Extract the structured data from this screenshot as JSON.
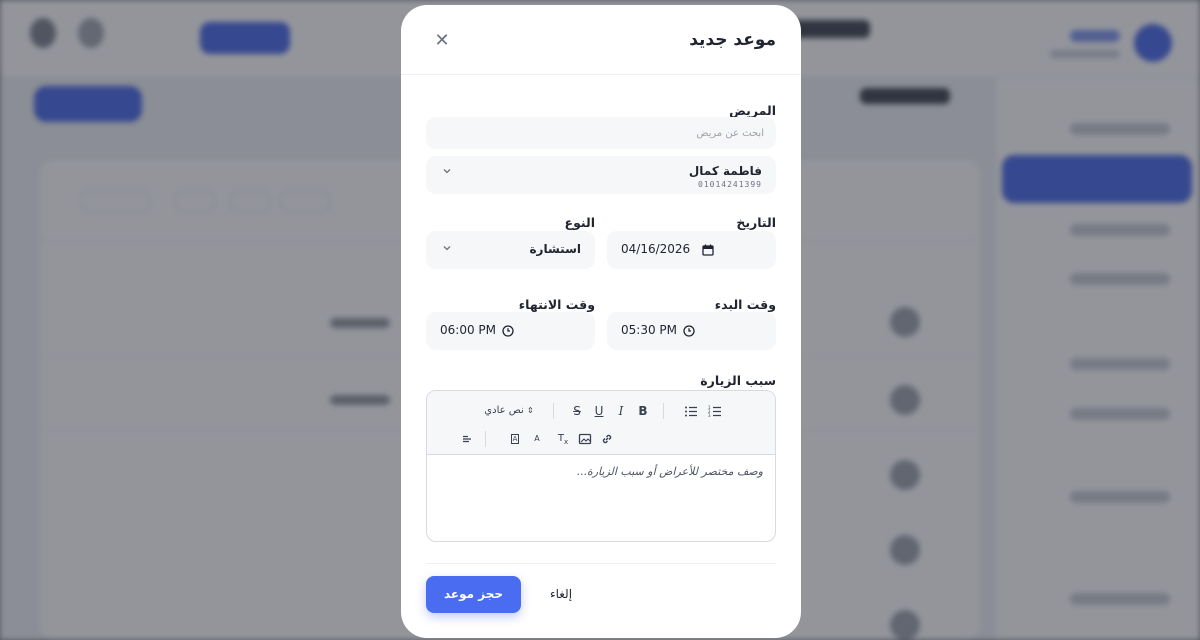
{
  "modal": {
    "title": "موعد جديد",
    "patient_label": "المريض",
    "patient_search_placeholder": "ابحث عن مريض",
    "selected_patient": {
      "name": "فاطمة كمال",
      "phone": "01014241399"
    },
    "date_label": "التاريخ",
    "date_value": "04/16/2026",
    "type_label": "النوع",
    "type_value": "استشارة",
    "start_label": "وقت البدء",
    "start_value": "05:30 PM",
    "end_label": "وقت الانتهاء",
    "end_value": "06:00 PM",
    "reason_label": "سبب الزيارة",
    "editor": {
      "header_option": "نص عادي",
      "placeholder": "وصف مختصر للأعراض أو سبب الزيارة..."
    },
    "submit_label": "حجز موعد",
    "cancel_label": "إلغاء"
  },
  "colors": {
    "primary": "#4a6cf0",
    "text": "#1f2430",
    "field_bg": "#f6f7f9"
  }
}
